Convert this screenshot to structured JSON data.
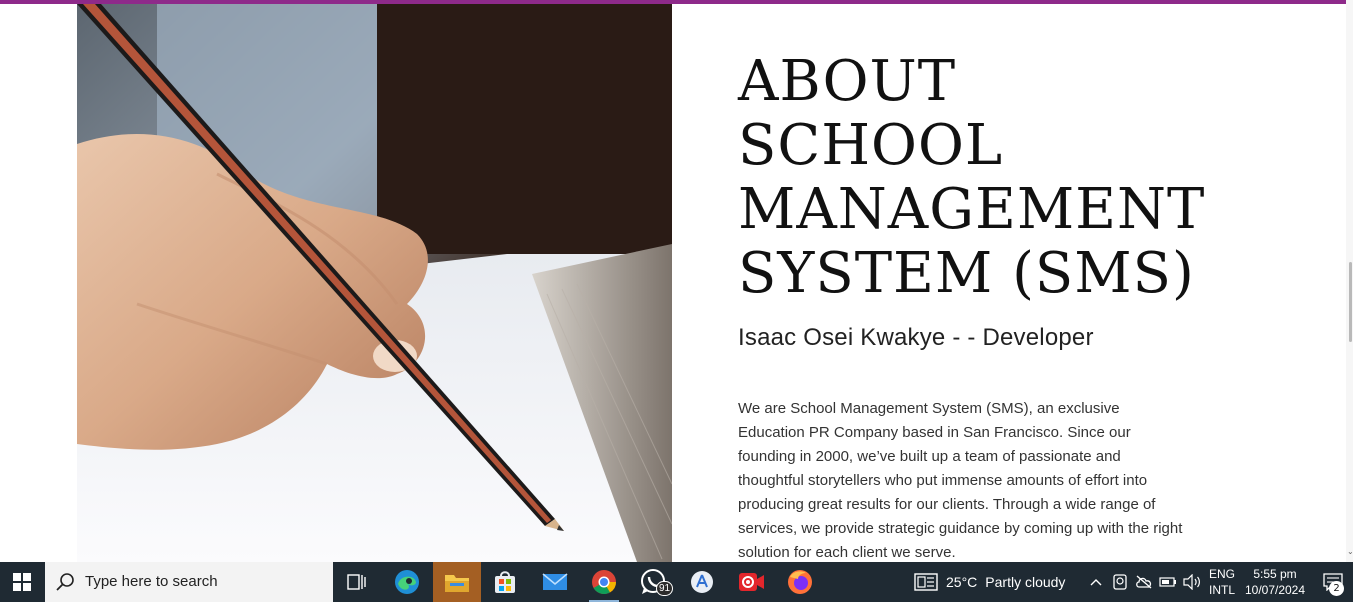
{
  "page": {
    "accent_color": "#8e2a8a",
    "image_alt": "Hand writing with a pencil on paper",
    "heading_lines": [
      "ABOUT",
      "SCHOOL",
      "MANAGEMENT",
      "SYSTEM (SMS)"
    ],
    "subtitle": "Isaac Osei Kwakye - - Developer",
    "body": "We are School Management System (SMS), an exclusive Education PR Company based in San Francisco. Since our founding in 2000, we’ve built up a team of passionate and thoughtful storytellers who put immense amounts of effort into producing great results for our clients. Through a wide range of services, we provide strategic guidance by coming up with the right solution for each client we serve."
  },
  "taskbar": {
    "start_icon": "windows-logo-icon",
    "search_placeholder": "Type here to search",
    "apps": [
      {
        "name": "task-view",
        "icon": "task-view-icon"
      },
      {
        "name": "edge",
        "icon": "edge-icon"
      },
      {
        "name": "file-explorer",
        "icon": "folder-icon"
      },
      {
        "name": "microsoft-store",
        "icon": "store-icon"
      },
      {
        "name": "mail",
        "icon": "mail-icon"
      },
      {
        "name": "chrome",
        "icon": "chrome-icon"
      },
      {
        "name": "whatsapp",
        "icon": "whatsapp-icon",
        "badge": "91"
      },
      {
        "name": "app-store",
        "icon": "app-store-icon"
      },
      {
        "name": "screen-recorder",
        "icon": "recorder-icon"
      },
      {
        "name": "firefox",
        "icon": "firefox-icon"
      }
    ],
    "weather": {
      "temp": "25°C",
      "condition": "Partly cloudy"
    },
    "language": {
      "line1": "ENG",
      "line2": "INTL"
    },
    "clock": {
      "time": "5:55 pm",
      "date": "10/07/2024"
    },
    "notifications": "2"
  }
}
